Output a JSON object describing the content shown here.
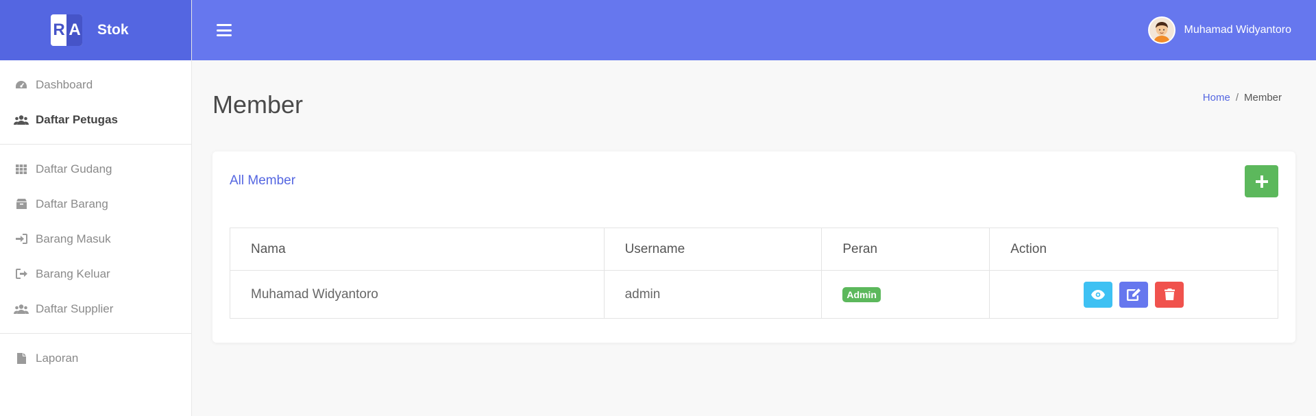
{
  "brand": {
    "logo_text": "RA",
    "name": "Stok"
  },
  "sidebar": {
    "groups": [
      [
        {
          "label": "Dashboard",
          "icon": "dashboard-icon"
        },
        {
          "label": "Daftar Petugas",
          "icon": "users-icon",
          "active": true
        }
      ],
      [
        {
          "label": "Daftar Gudang",
          "icon": "grid-icon"
        },
        {
          "label": "Daftar Barang",
          "icon": "box-icon"
        },
        {
          "label": "Barang Masuk",
          "icon": "sign-in-icon"
        },
        {
          "label": "Barang Keluar",
          "icon": "sign-out-icon"
        },
        {
          "label": "Daftar Supplier",
          "icon": "users-icon"
        }
      ],
      [
        {
          "label": "Laporan",
          "icon": "file-icon"
        }
      ]
    ]
  },
  "topbar": {
    "user_name": "Muhamad Widyantoro"
  },
  "page": {
    "title": "Member",
    "breadcrumb": {
      "home": "Home",
      "separator": "/",
      "current": "Member"
    }
  },
  "card": {
    "title": "All Member",
    "table": {
      "headers": [
        "Nama",
        "Username",
        "Peran",
        "Action"
      ],
      "rows": [
        {
          "nama": "Muhamad Widyantoro",
          "username": "admin",
          "peran": "Admin"
        }
      ]
    }
  },
  "colors": {
    "brand": "#5466e1",
    "topbar": "#6677ee",
    "success": "#5cb85c",
    "info": "#3ec1f3",
    "danger": "#f0524d"
  }
}
